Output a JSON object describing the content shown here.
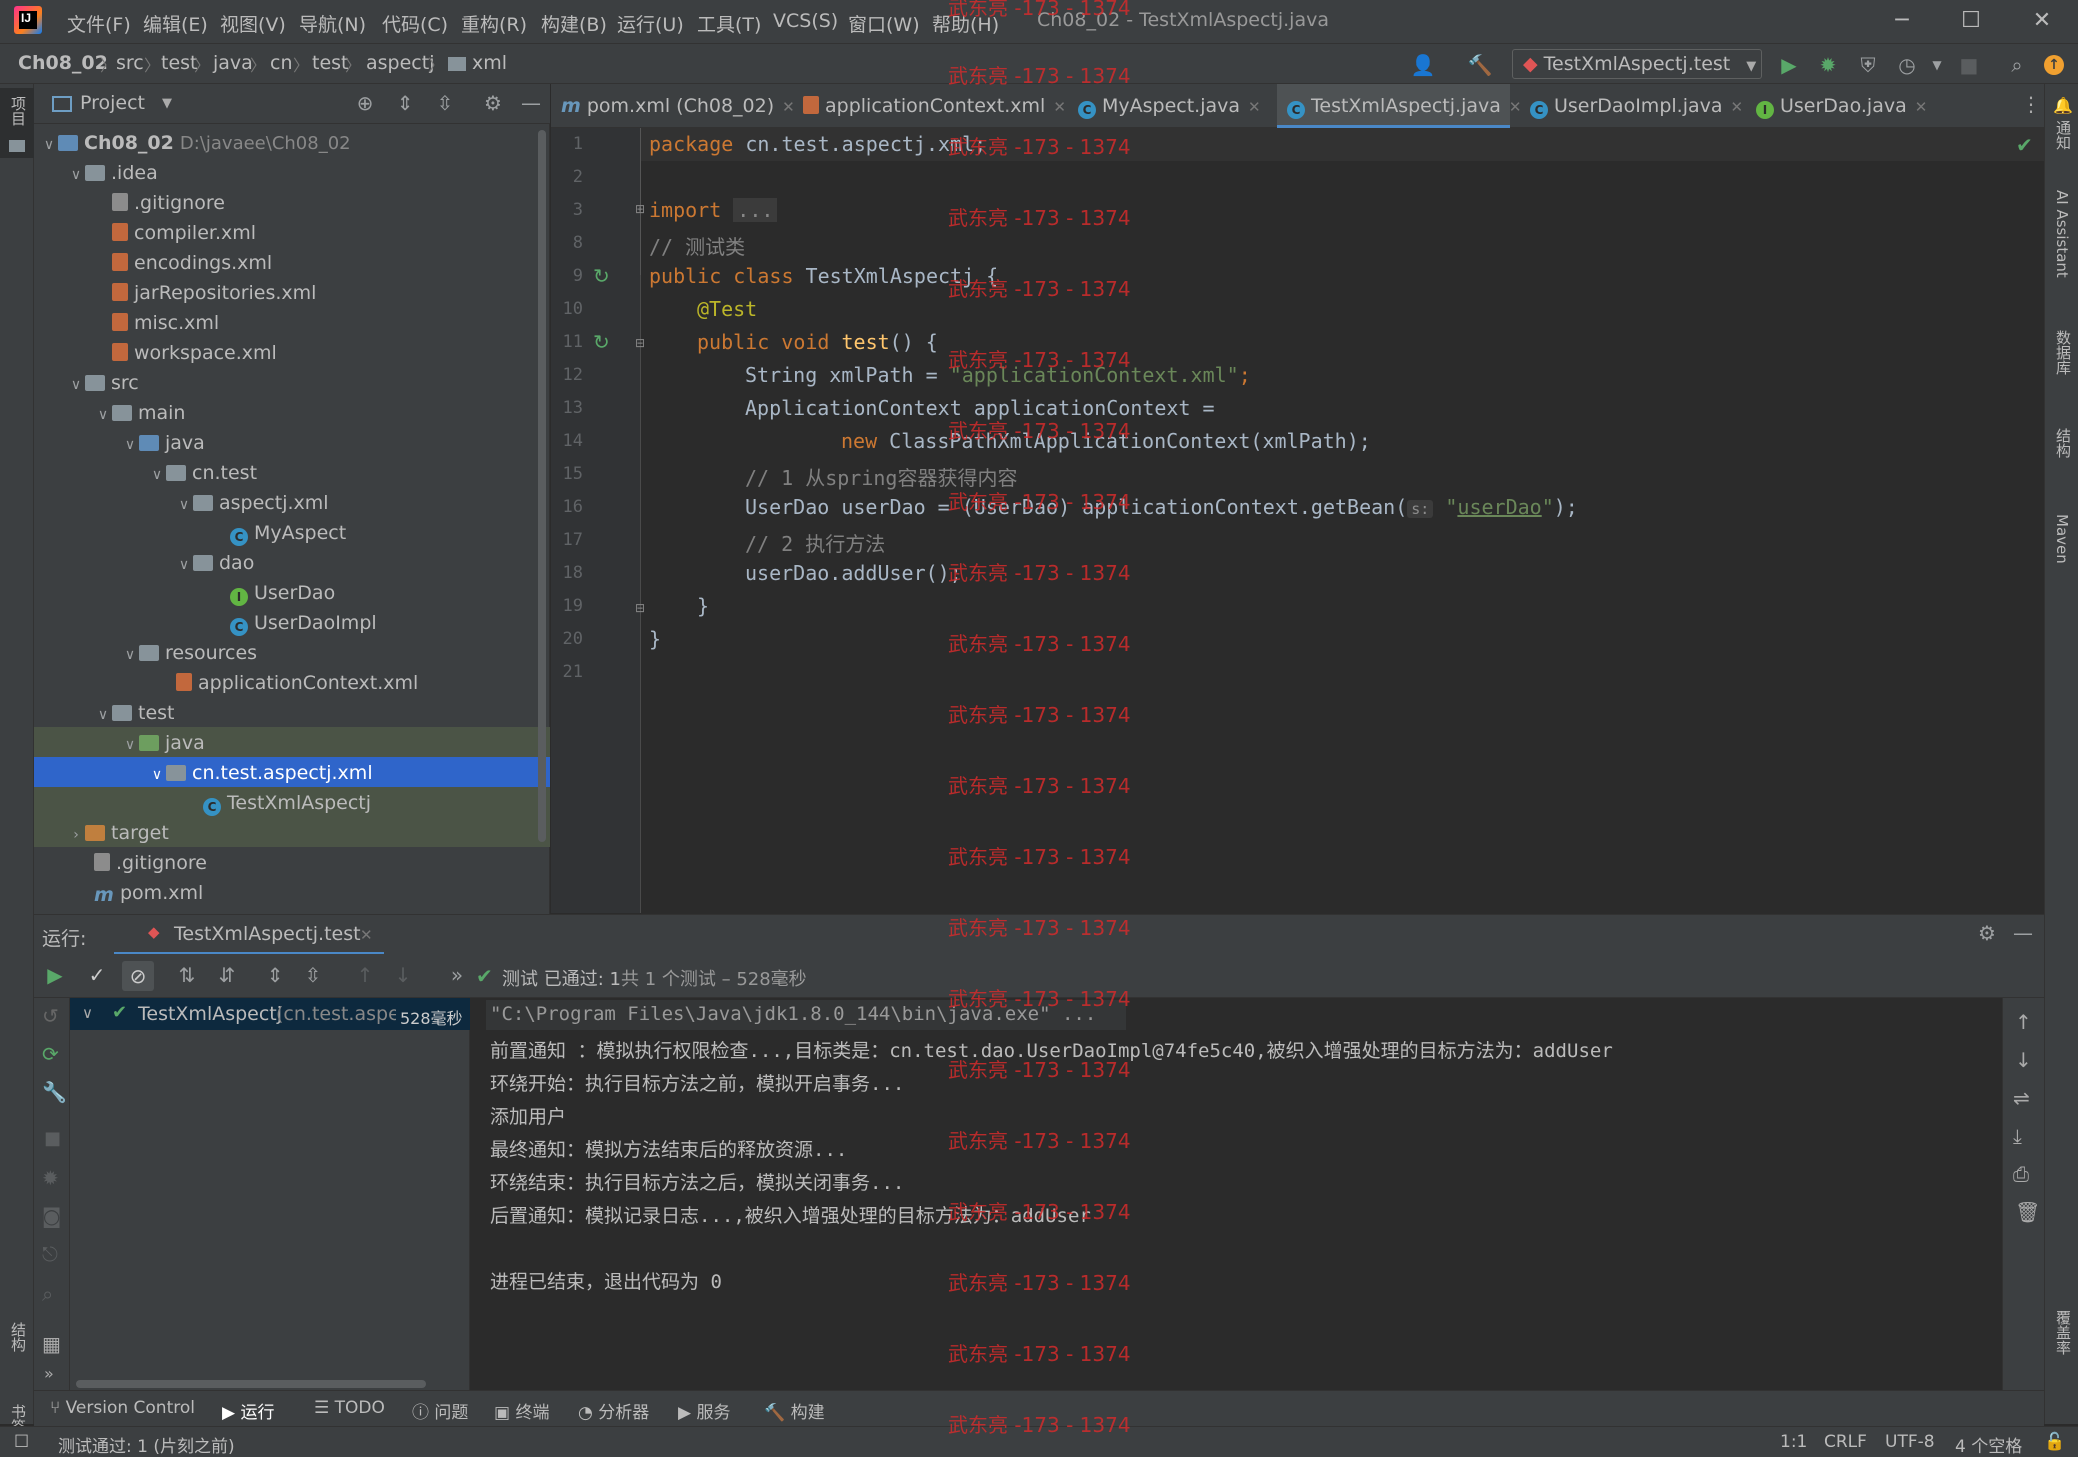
{
  "title_bar": {
    "menus": [
      "文件(F)",
      "编辑(E)",
      "视图(V)",
      "导航(N)",
      "代码(C)",
      "重构(R)",
      "构建(B)",
      "运行(U)",
      "工具(T)",
      "VCS(S)",
      "窗口(W)",
      "帮助(H)"
    ],
    "window_title": "Ch08_02 - TestXmlAspectj.java"
  },
  "breadcrumb": [
    "Ch08_02",
    "src",
    "test",
    "java",
    "cn",
    "test",
    "aspectj",
    "xml"
  ],
  "run_config": "TestXmlAspectj.test",
  "left_stripe": {
    "project": "项目",
    "structure": "结构",
    "bookmarks": "书签"
  },
  "right_stripe": {
    "notifications": "通知",
    "ai": "AI Assistant",
    "database": "数据库",
    "structure": "结构",
    "maven": "Maven",
    "coverage": "覆盖率"
  },
  "project_panel": {
    "title": "Project",
    "tree": [
      {
        "label": "Ch08_02",
        "path": "D:\\javaee\\Ch08_02"
      },
      {
        "label": ".idea"
      },
      {
        "label": ".gitignore"
      },
      {
        "label": "compiler.xml"
      },
      {
        "label": "encodings.xml"
      },
      {
        "label": "jarRepositories.xml"
      },
      {
        "label": "misc.xml"
      },
      {
        "label": "workspace.xml"
      },
      {
        "label": "src"
      },
      {
        "label": "main"
      },
      {
        "label": "java"
      },
      {
        "label": "cn.test"
      },
      {
        "label": "aspectj.xml"
      },
      {
        "label": "MyAspect"
      },
      {
        "label": "dao"
      },
      {
        "label": "UserDao"
      },
      {
        "label": "UserDaoImpl"
      },
      {
        "label": "resources"
      },
      {
        "label": "applicationContext.xml"
      },
      {
        "label": "test"
      },
      {
        "label": "java"
      },
      {
        "label": "cn.test.aspectj.xml"
      },
      {
        "label": "TestXmlAspectj"
      },
      {
        "label": "target"
      },
      {
        "label": ".gitignore"
      },
      {
        "label": "pom.xml"
      }
    ]
  },
  "editor_tabs": [
    {
      "label": "pom.xml (Ch08_02)"
    },
    {
      "label": "applicationContext.xml"
    },
    {
      "label": "MyAspect.java"
    },
    {
      "label": "TestXmlAspectj.java",
      "active": true
    },
    {
      "label": "UserDaoImpl.java"
    },
    {
      "label": "UserDao.java"
    }
  ],
  "editor": {
    "line_numbers": [
      "1",
      "2",
      "3",
      "8",
      "9",
      "10",
      "11",
      "12",
      "13",
      "14",
      "15",
      "16",
      "17",
      "18",
      "19",
      "20",
      "21"
    ],
    "code": {
      "l1_kw": "package",
      "l1_rest": " cn.test.aspectj.xml;",
      "l3_kw": "import",
      "l3_fold": "...",
      "l8": "// 测试类",
      "l9_kw": "public class",
      "l9_rest": " TestXmlAspectj {",
      "l10": "@Test",
      "l11_kw": "public void",
      "l11_fn": "test",
      "l11_rest": "() {",
      "l12_a": "String xmlPath = ",
      "l12_str": "\"applicationContext.xml\"",
      "l12_b": ";",
      "l13": "ApplicationContext applicationContext =",
      "l14_kw": "new",
      "l14_rest": " ClassPathXmlApplicationContext(xmlPath);",
      "l15": "// 1 从spring容器获得内容",
      "l16_a": "UserDao userDao = (UserDao) applicationContext.getBean(",
      "l16_hint": "s:",
      "l16_q1": "\"",
      "l16_str": "userDao",
      "l16_q2": "\"",
      "l16_b": ");",
      "l17": "// 2 执行方法",
      "l18": "userDao.addUser();",
      "l19": "}",
      "l20": "}"
    }
  },
  "run_panel": {
    "label": "运行:",
    "tab": "TestXmlAspectj.test",
    "status_prefix": "测试 已通过:",
    "status_count": "1",
    "status_rest": "共 1 个测试 – 528毫秒",
    "tree_item": "TestXmlAspectj",
    "tree_item_pkg": "(cn.test.aspect",
    "tree_item_time": "528毫秒",
    "console": [
      "\"C:\\Program Files\\Java\\jdk1.8.0_144\\bin\\java.exe\" ...",
      "前置通知 ：模拟执行权限检查...,目标类是：cn.test.dao.UserDaoImpl@74fe5c40,被织入增强处理的目标方法为：addUser",
      "环绕开始：执行目标方法之前，模拟开启事务...",
      "添加用户",
      "最终通知：模拟方法结束后的释放资源...",
      "环绕结束：执行目标方法之后，模拟关闭事务...",
      "后置通知：模拟记录日志...,被织入增强处理的目标方法为：addUser",
      "",
      "进程已结束，退出代码为 0"
    ]
  },
  "tool_windows": [
    "Version Control",
    "运行",
    "TODO",
    "问题",
    "终端",
    "分析器",
    "服务",
    "构建"
  ],
  "status_bar": {
    "message": "测试通过: 1 (片刻之前)",
    "position": "1:1",
    "line_sep": "CRLF",
    "encoding": "UTF-8",
    "indent": "4 个空格"
  },
  "watermark": "武东亮 -173 - 1374"
}
